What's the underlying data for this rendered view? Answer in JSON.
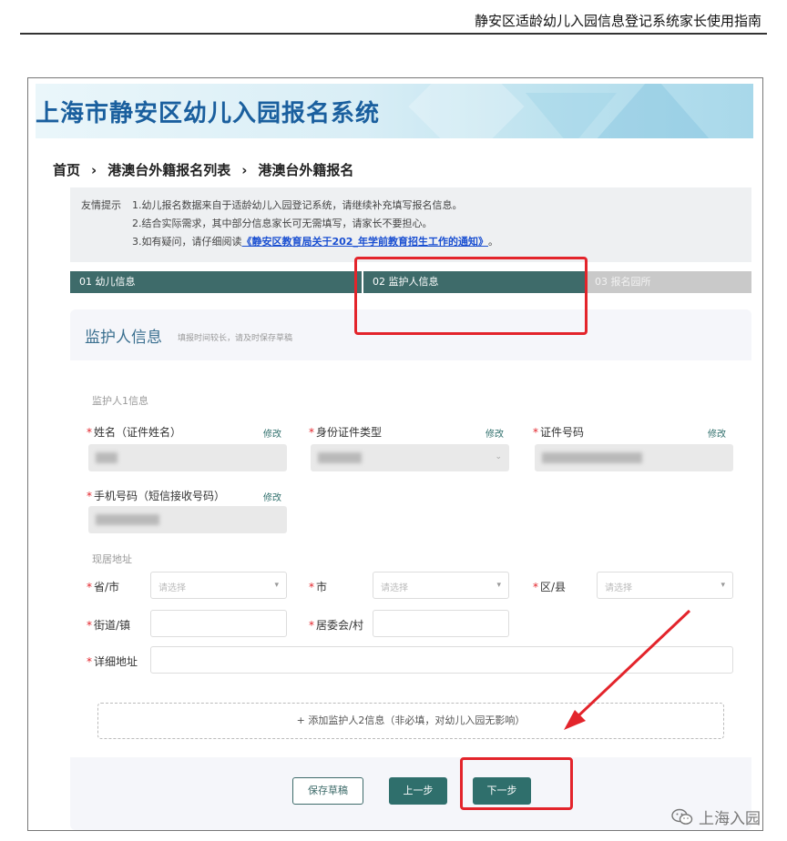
{
  "document": {
    "header_title": "静安区适龄幼儿入园信息登记系统家长使用指南"
  },
  "app": {
    "banner_title": "上海市静安区幼儿入园报名系统"
  },
  "breadcrumb": {
    "items": [
      "首页",
      "港澳台外籍报名列表",
      "港澳台外籍报名"
    ],
    "separator": "›"
  },
  "tips": {
    "label": "友情提示",
    "line1": "1.幼儿报名数据来自于适龄幼儿入园登记系统，请继续补充填写报名信息。",
    "line2": "2.结合实际需求，其中部分信息家长可无需填写，请家长不要担心。",
    "line3_prefix": "3.如有疑问，请仔细阅读",
    "line3_link": "《静安区教育局关于202_年学前教育招生工作的通知》",
    "line3_suffix": "。"
  },
  "steps": [
    "01 幼儿信息",
    "02 监护人信息",
    "03 报名园所"
  ],
  "section": {
    "title": "监护人信息",
    "subtitle": "填报时间较长，请及时保存草稿"
  },
  "guardian1": {
    "label": "监护人1信息",
    "name_label": "姓名（证件姓名）",
    "id_type_label": "身份证件类型",
    "id_number_label": "证件号码",
    "phone_label": "手机号码（短信接收号码）",
    "edit_label": "修改"
  },
  "address": {
    "label": "现居地址",
    "province_label": "省/市",
    "city_label": "市",
    "district_label": "区/县",
    "street_label": "街道/镇",
    "committee_label": "居委会/村",
    "detail_label": "详细地址",
    "select_placeholder": "请选择"
  },
  "add_guardian_label": "+ 添加监护人2信息（非必填，对幼儿入园无影响）",
  "buttons": {
    "save_draft": "保存草稿",
    "prev": "上一步",
    "next": "下一步"
  },
  "watermark": {
    "text": "上海入园",
    "icon": "wechat-icon"
  },
  "colors": {
    "accent": "#2f6f6c",
    "highlight": "#e3242b",
    "banner_title": "#1a5f9e"
  }
}
